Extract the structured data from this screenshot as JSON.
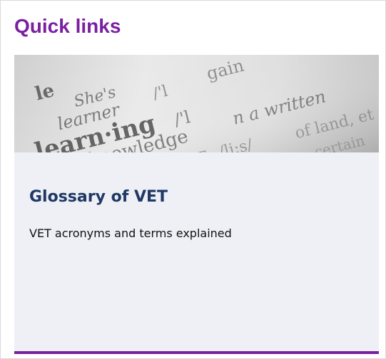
{
  "widget": {
    "title": "Quick links"
  },
  "card": {
    "title": "Glossary of VET",
    "description": "VET acronyms and terms explained",
    "image": {
      "icon": "dictionary-photo",
      "accent_color": "#7b1fa2"
    }
  },
  "colors": {
    "accent": "#7b1fa2",
    "card_background": "#eef0f6",
    "card_title": "#1f3864"
  }
}
